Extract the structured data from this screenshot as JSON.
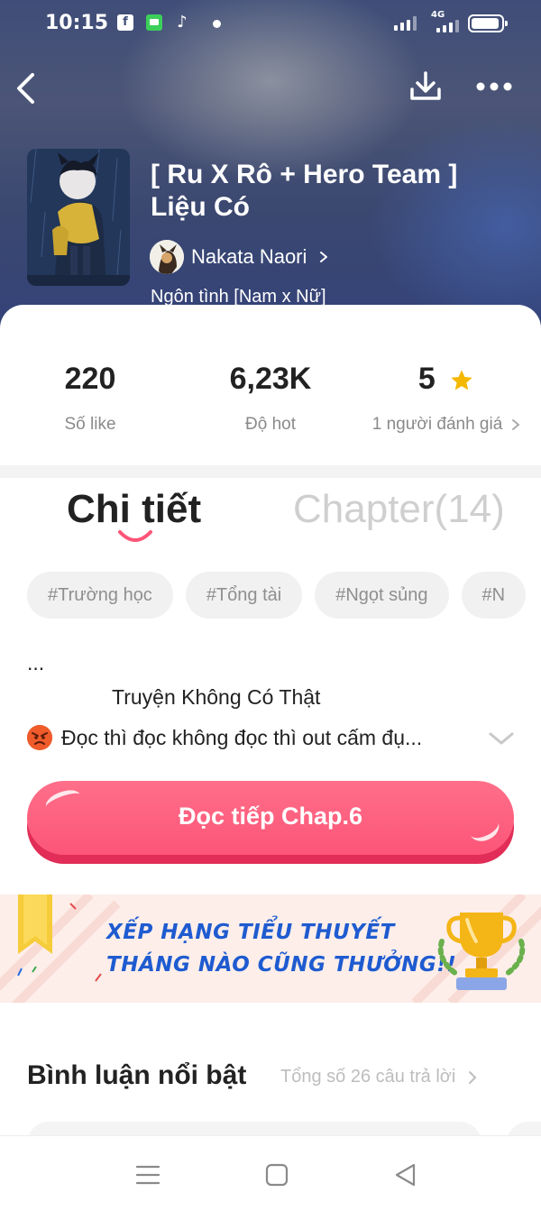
{
  "status_bar": {
    "time": "10:15",
    "fb_glyph": "f",
    "tiktok_glyph": "♪",
    "network": "4G"
  },
  "header": {
    "back_icon": "chevron-left-icon",
    "download_icon": "download-icon",
    "more_icon": "more-horizontal-icon"
  },
  "story": {
    "title": "[ Ru X Rô + Hero Team ] Liệu Có",
    "author": "Nakata Naori",
    "genre": "Ngôn tình [Nam x Nữ]"
  },
  "stats": {
    "likes": {
      "value": "220",
      "label": "Số like"
    },
    "hot": {
      "value": "6,23K",
      "label": "Độ hot"
    },
    "rating": {
      "value": "5",
      "label": "1 người đánh giá"
    }
  },
  "tabs": {
    "detail": "Chi tiết",
    "chapters": "Chapter(14)"
  },
  "tags": [
    "#Trường học",
    "#Tổng tài",
    "#Ngọt sủng",
    "#N"
  ],
  "description": {
    "line1": "...",
    "line2": "Truyện Không Có Thật",
    "line3": "Đọc thì đọc không đọc thì out cấm đụ..."
  },
  "cta": {
    "label": "Đọc tiếp Chap.6"
  },
  "banner": {
    "line1": "XẾP HẠNG TIỂU THUYẾT",
    "line2": "THÁNG NÀO CŨNG THƯỞNG!!"
  },
  "comments": {
    "title": "Bình luận nổi bật",
    "total": "Tổng số 26 câu trả lời"
  },
  "colors": {
    "accent": "#fc5578",
    "accent_dark": "#e12d57",
    "banner_blue": "#1e5bd0",
    "star": "#f5b800"
  }
}
